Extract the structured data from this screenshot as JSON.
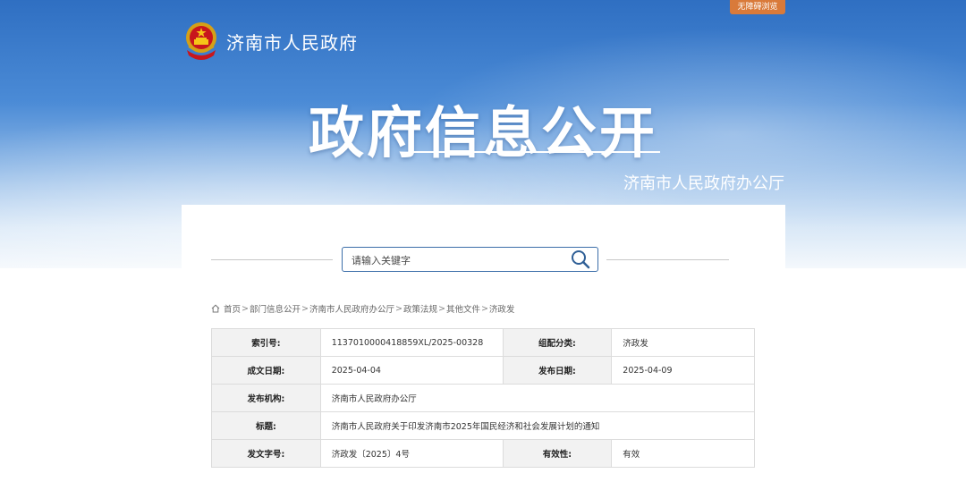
{
  "header": {
    "accessibility_label": "无障碍浏览",
    "site_title": "济南市人民政府",
    "headline": "政府信息公开",
    "department": "济南市人民政府办公厅"
  },
  "search": {
    "placeholder": "请输入关键字"
  },
  "breadcrumb": {
    "items": [
      "首页",
      "部门信息公开",
      "济南市人民政府办公厅",
      "政策法规",
      "其他文件",
      "济政发"
    ],
    "separator": ">"
  },
  "info_table": {
    "index_no": {
      "label": "索引号:",
      "value": "113701000041885 9XL/2025-00328"
    },
    "category": {
      "label": "组配分类:",
      "value": "济政发"
    },
    "written_date": {
      "label": "成文日期:",
      "value": "2025-04-04"
    },
    "publish_date": {
      "label": "发布日期:",
      "value": "2025-04-09"
    },
    "issuer": {
      "label": "发布机构:",
      "value": "济南市人民政府办公厅"
    },
    "title": {
      "label": "标题:",
      "value": "济南市人民政府关于印发济南市2025年国民经济和社会发展计划的通知"
    },
    "doc_no": {
      "label": "发文字号:",
      "value": "济政发〔2025〕4号"
    },
    "validity": {
      "label": "有效性:",
      "value": "有效"
    }
  },
  "colors": {
    "banner_top": "#2f6fc2",
    "accessibility_bg": "#d97a3a",
    "search_border": "#3b6ea9",
    "label_bg": "#f2f2f2"
  }
}
